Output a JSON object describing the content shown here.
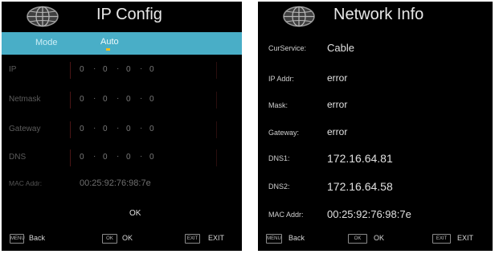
{
  "ip_config": {
    "title": "IP Config",
    "mode": {
      "label": "Mode",
      "value": "Auto"
    },
    "fields": [
      {
        "label": "IP",
        "octets": [
          "0",
          "0",
          "0",
          "0"
        ]
      },
      {
        "label": "Netmask",
        "octets": [
          "0",
          "0",
          "0",
          "0"
        ]
      },
      {
        "label": "Gateway",
        "octets": [
          "0",
          "0",
          "0",
          "0"
        ]
      },
      {
        "label": "DNS",
        "octets": [
          "0",
          "0",
          "0",
          "0"
        ]
      }
    ],
    "mac": {
      "label": "MAC Addr:",
      "value": "00:25:92:76:98:7e"
    },
    "ok_label": "OK",
    "footer": {
      "menu_key": "MENU",
      "back_label": "Back",
      "ok_key": "OK",
      "ok_label": "OK",
      "exit_key": "EXIT",
      "exit_label": "EXIT"
    }
  },
  "network_info": {
    "title": "Network Info",
    "rows": [
      {
        "label": "CurService:",
        "value": "Cable"
      },
      {
        "label": "IP Addr:",
        "value": "error"
      },
      {
        "label": "Mask:",
        "value": "error"
      },
      {
        "label": "Gateway:",
        "value": "error"
      },
      {
        "label": "DNS1:",
        "value": "172.16.64.81"
      },
      {
        "label": "DNS2:",
        "value": "172.16.64.58"
      },
      {
        "label": "MAC Addr:",
        "value": "00:25:92:76:98:7e"
      }
    ],
    "footer": {
      "menu_key": "MENU",
      "back_label": "Back",
      "ok_key": "OK",
      "ok_label": "OK",
      "exit_key": "EXIT",
      "exit_label": "EXIT"
    }
  },
  "icons": {
    "globe": "globe-icon"
  },
  "colors": {
    "highlight": "#49aec7",
    "background": "#000000",
    "caret": "#f2c021"
  }
}
